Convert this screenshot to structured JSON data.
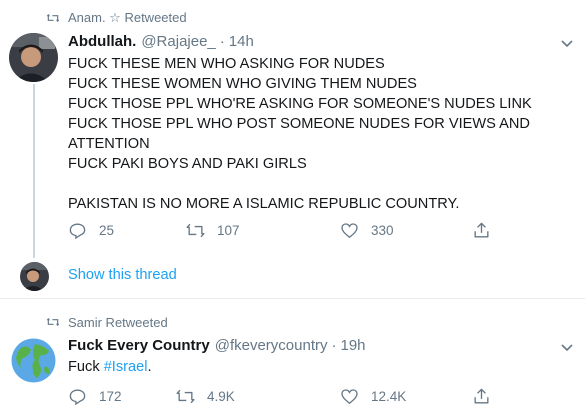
{
  "tweets": [
    {
      "retweeted_by": "Anam. ☆ Retweeted",
      "name": "Abdullah.",
      "handle": "@Rajajee_",
      "separator": "·",
      "time": "14h",
      "body": "FUCK THESE MEN WHO ASKING FOR NUDES\nFUCK THESE WOMEN WHO GIVING THEM NUDES\nFUCK THOSE PPL WHO'RE ASKING FOR SOMEONE'S NUDES LINK\nFUCK THOSE PPL WHO POST SOMEONE NUDES FOR VIEWS AND ATTENTION\nFUCK PAKI BOYS AND PAKI GIRLS\n\nPAKISTAN IS NO MORE A ISLAMIC REPUBLIC COUNTRY.",
      "replies": "25",
      "retweets": "107",
      "likes": "330",
      "show_thread": "Show this thread"
    },
    {
      "retweeted_by": "Samir Retweeted",
      "name": "Fuck Every Country",
      "handle": "@fkeverycountry",
      "separator": "·",
      "time": "19h",
      "body_prefix": "Fuck ",
      "body_hashtag": "#Israel",
      "body_suffix": ".",
      "replies": "172",
      "retweets": "4.9K",
      "likes": "12.4K"
    }
  ],
  "colors": {
    "link": "#1da1f2",
    "secondary_text": "#657786",
    "primary_text": "#14171a",
    "divider": "#e6ecf0"
  },
  "icons": {
    "retweet_label": "retweet-icon",
    "reply": "reply-icon",
    "retweet": "retweet-icon",
    "like": "heart-icon",
    "share": "share-icon",
    "more": "chevron-down-icon"
  }
}
